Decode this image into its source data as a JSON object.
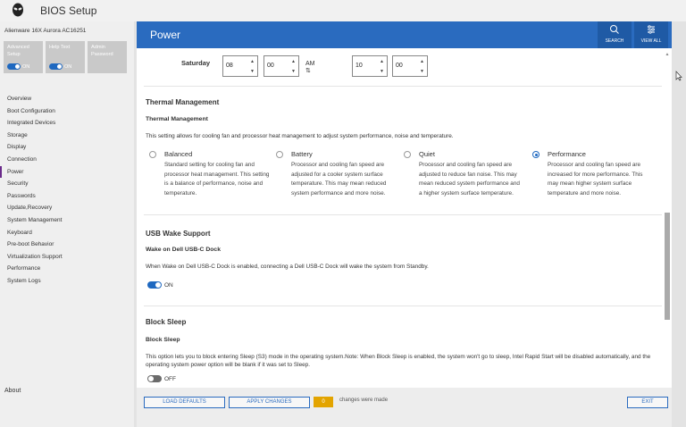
{
  "app": {
    "title": "BIOS Setup",
    "model": "Alienware 16X Aurora AC16251"
  },
  "modes": [
    {
      "label": "Advanced Setup",
      "toggle": "ON",
      "has_toggle": true
    },
    {
      "label": "Help Text",
      "toggle": "ON",
      "has_toggle": true
    },
    {
      "label": "Admin Password",
      "toggle": "",
      "has_toggle": false
    }
  ],
  "nav": {
    "items": [
      "Overview",
      "Boot Configuration",
      "Integrated Devices",
      "Storage",
      "Display",
      "Connection",
      "Power",
      "Security",
      "Passwords",
      "Update,Recovery",
      "System Management",
      "Keyboard",
      "Pre-boot Behavior",
      "Virtualization Support",
      "Performance",
      "System Logs"
    ],
    "active": "Power",
    "about": "About"
  },
  "header": {
    "title": "Power",
    "search_label": "SEARCH",
    "view_all_label": "VIEW ALL"
  },
  "schedule": {
    "day": "Saturday",
    "hour": "08",
    "minute": "00",
    "ampm": "AM",
    "hour2": "10",
    "minute2": "00"
  },
  "thermal": {
    "section_title": "Thermal Management",
    "setting_name": "Thermal Management",
    "description": "This setting allows for cooling fan and processor heat management to adjust system performance, noise and temperature.",
    "options": [
      {
        "label": "Balanced",
        "desc": "Standard setting for cooling fan and processor heat management. This setting is a balance of performance, noise and temperature.",
        "checked": false
      },
      {
        "label": "Battery",
        "desc": "Processor and cooling fan speed are adjusted for a cooler system surface temperature. This may mean reduced system performance and more noise.",
        "checked": false
      },
      {
        "label": "Quiet",
        "desc": "Processor and cooling fan speed are adjusted to reduce fan noise. This may mean reduced system performance and a higher system surface temperature.",
        "checked": false
      },
      {
        "label": "Performance",
        "desc": "Processor and cooling fan speed are increased for more performance. This may mean higher system surface temperature and more noise.",
        "checked": true
      }
    ]
  },
  "usb_wake": {
    "section_title": "USB Wake Support",
    "setting_name": "Wake on Dell USB-C Dock",
    "description": "When Wake on Dell USB-C Dock is enabled, connecting a Dell USB-C Dock will wake the system from Standby.",
    "toggle_label": "ON"
  },
  "block_sleep": {
    "section_title": "Block Sleep",
    "setting_name": "Block Sleep",
    "description": "This option lets you to block entering Sleep (S3) mode in the operating system.Note: When Block Sleep is enabled, the system won't go to sleep, Intel Rapid Start will be disabled automatically, and the operating system power option will be blank if it was set to Sleep.",
    "toggle_label": "OFF"
  },
  "footer": {
    "load_defaults": "LOAD DEFAULTS",
    "apply_changes": "APPLY CHANGES",
    "changes_count": "0",
    "changes_text": "changes were made",
    "exit": "EXIT"
  },
  "colors": {
    "accent": "#2a6bbf",
    "header_dark": "#1f5aa5",
    "badge": "#e3a400",
    "active_nav": "#6a2a8a"
  }
}
